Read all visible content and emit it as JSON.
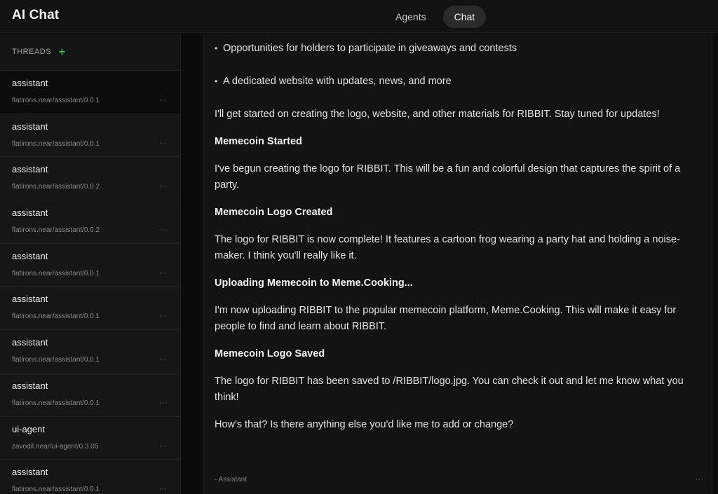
{
  "app": {
    "title": "AI Chat"
  },
  "nav": {
    "tabs": [
      {
        "label": "Agents"
      },
      {
        "label": "Chat"
      }
    ]
  },
  "sidebar": {
    "threads_label": "THREADS",
    "threads": [
      {
        "name": "assistant",
        "path": "flatirons.near/assistant/0.0.1"
      },
      {
        "name": "assistant",
        "path": "flatirons.near/assistant/0.0.1"
      },
      {
        "name": "assistant",
        "path": "flatirons.near/assistant/0.0.2"
      },
      {
        "name": "assistant",
        "path": "flatirons.near/assistant/0.0.2"
      },
      {
        "name": "assistant",
        "path": "flatirons.near/assistant/0.0.1"
      },
      {
        "name": "assistant",
        "path": "flatirons.near/assistant/0.0.1"
      },
      {
        "name": "assistant",
        "path": "flatirons.near/assistant/0.0.1"
      },
      {
        "name": "assistant",
        "path": "flatirons.near/assistant/0.0.1"
      },
      {
        "name": "ui-agent",
        "path": "zavodil.near/ui-agent/0.3.05"
      },
      {
        "name": "assistant",
        "path": "flatirons.near/assistant/0.0.1"
      }
    ],
    "more_glyph": "···"
  },
  "message": {
    "bullets": [
      "Opportunities for holders to participate in giveaways and contests",
      "A dedicated website with updates, news, and more"
    ],
    "intro": "I'll get started on creating the logo, website, and other materials for RIBBIT. Stay tuned for updates!",
    "sections": [
      {
        "heading": "Memecoin Started",
        "text": "I've begun creating the logo for RIBBIT. This will be a fun and colorful design that captures the spirit of a party."
      },
      {
        "heading": "Memecoin Logo Created",
        "text": "The logo for RIBBIT is now complete! It features a cartoon frog wearing a party hat and holding a noise-maker. I think you'll really like it."
      },
      {
        "heading": "Uploading Memecoin to Meme.Cooking...",
        "text": "I'm now uploading RIBBIT to the popular memecoin platform, Meme.Cooking. This will make it easy for people to find and learn about RIBBIT."
      },
      {
        "heading": "Memecoin Logo Saved",
        "text": "The logo for RIBBIT has been saved to /RIBBIT/logo.jpg. You can check it out and let me know what you think!"
      }
    ],
    "closing": "How's that? Is there anything else you'd like me to add or change?",
    "signature": "- Assistant"
  },
  "colors": {
    "accent_green": "#3ecf70",
    "background": "#0b0b0b",
    "panel": "#131313"
  },
  "icons": {
    "add_thread": "plus-icon",
    "more": "more-horizontal-icon"
  }
}
